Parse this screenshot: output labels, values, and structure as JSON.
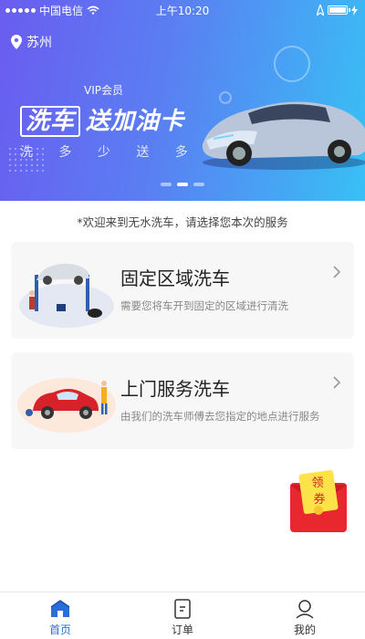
{
  "status_bar": {
    "carrier": "中国电信",
    "time": "上午10:20"
  },
  "location": {
    "city": "苏州"
  },
  "banner": {
    "vip_label": "VIP会员",
    "headline_boxed": "洗车",
    "headline_rest": "送加油卡",
    "subline": "洗 多 少 送 多 少",
    "active_index": 1,
    "slide_count": 3
  },
  "welcome_text": "*欢迎来到无水洗车，请选择您本次的服务",
  "services": [
    {
      "title": "固定区域洗车",
      "desc": "需要您将车开到固定的区域进行清洗",
      "illustration": "car-lift-illustration"
    },
    {
      "title": "上门服务洗车",
      "desc": "由我们的洗车师傅去您指定的地点进行服务",
      "illustration": "car-washing-illustration"
    }
  ],
  "coupon": {
    "line1": "领",
    "line2": "券"
  },
  "tabs": [
    {
      "label": "首页",
      "icon": "home-icon",
      "active": true
    },
    {
      "label": "订单",
      "icon": "order-icon",
      "active": false
    },
    {
      "label": "我的",
      "icon": "profile-icon",
      "active": false
    }
  ],
  "colors": {
    "accent": "#2b6fd6",
    "banner_start": "#6a5cf0",
    "banner_end": "#38c0f5",
    "coupon_red": "#e8272f"
  }
}
